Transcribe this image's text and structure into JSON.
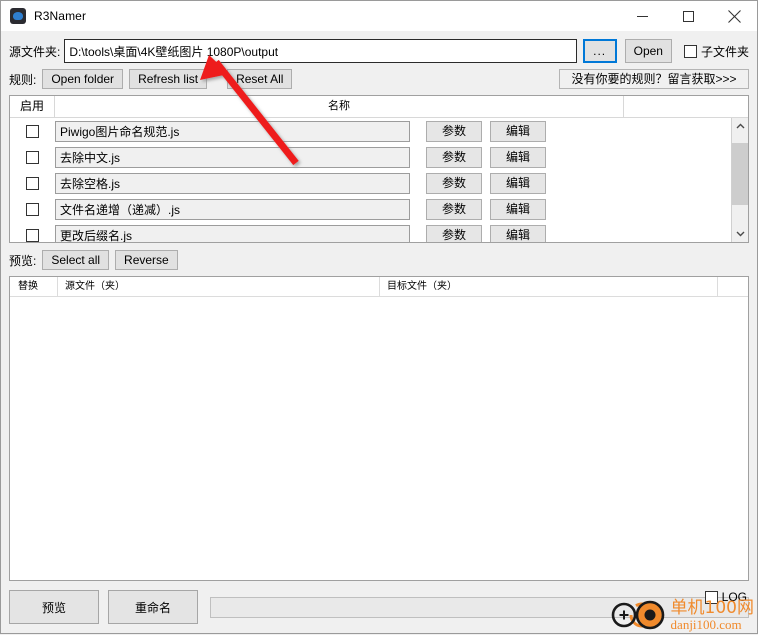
{
  "window": {
    "title": "R3Namer",
    "icon": "app-icon",
    "controls": {
      "minimize": "minimize-icon",
      "maximize": "maximize-icon",
      "close": "close-icon"
    }
  },
  "source": {
    "label": "源文件夹:",
    "path_value": "D:\\tools\\桌面\\4K壁纸图片 1080P\\output",
    "path_placeholder": "",
    "browse_label": "...",
    "open_label": "Open",
    "subfolder_label": "子文件夹",
    "subfolder_checked": false
  },
  "rules_toolbar": {
    "label": "规则:",
    "open_folder_label": "Open folder",
    "refresh_list_label": "Refresh list",
    "reset_all_label": "Reset All",
    "get_rule_label": "没有你要的规则？留言获取>>>"
  },
  "rules_table": {
    "headers": {
      "enable": "启用",
      "name": "名称"
    },
    "param_label": "参数",
    "edit_label": "编辑",
    "rows": [
      {
        "enabled": false,
        "name": "Piwigo图片命名规范.js"
      },
      {
        "enabled": false,
        "name": "去除中文.js"
      },
      {
        "enabled": false,
        "name": "去除空格.js"
      },
      {
        "enabled": false,
        "name": "文件名递增（递减）.js"
      },
      {
        "enabled": false,
        "name": "更改后缀名.js"
      }
    ],
    "scrollbar": {
      "up_arrow": "chevron-up-icon",
      "down_arrow": "chevron-down-icon"
    }
  },
  "preview_toolbar": {
    "label": "预览:",
    "select_all_label": "Select all",
    "reverse_label": "Reverse"
  },
  "preview_table": {
    "headers": {
      "replace": "替换",
      "source": "源文件（夹）",
      "target": "目标文件（夹）",
      "extra": ""
    },
    "rows": []
  },
  "bottom": {
    "preview_label": "预览",
    "rename_label": "重命名",
    "progress_value": "",
    "log_label": "LOG",
    "log_checked": false
  },
  "watermark": {
    "cn": "单机100网",
    "en": "danji100.com",
    "accent_color": "#f08a2c"
  },
  "annotation": {
    "arrow": "red-arrow-pointing-to-path-field",
    "color": "#ee1c1c"
  }
}
